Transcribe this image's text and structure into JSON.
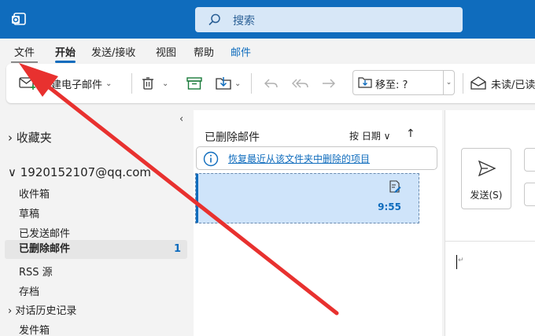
{
  "search": {
    "placeholder": "搜索"
  },
  "menu": {
    "file": "文件",
    "home": "开始",
    "send_receive": "发送/接收",
    "view": "视图",
    "help": "帮助",
    "mail": "邮件"
  },
  "ribbon": {
    "new_mail": "新建电子邮件",
    "move_to": "移至: ?",
    "unread_read": "未读/已读"
  },
  "folders": {
    "favorites": "收藏夹",
    "account": "1920152107@qq.com",
    "items": [
      {
        "label": "收件箱"
      },
      {
        "label": "草稿"
      },
      {
        "label": "已发送邮件"
      },
      {
        "label": "已删除邮件",
        "count": "1"
      },
      {
        "label": "RSS 源"
      },
      {
        "label": "存档"
      },
      {
        "label": "对话历史记录"
      },
      {
        "label": "发件箱"
      }
    ]
  },
  "list": {
    "title": "已删除邮件",
    "sort_label": "按 日期 ∨",
    "sort_direction": "↑",
    "recover_link": "恢复最近从该文件夹中删除的项目",
    "messages": [
      {
        "time": "9:55"
      }
    ]
  },
  "compose": {
    "send_label": "发送(S)"
  },
  "colors": {
    "brand": "#0f6cbd",
    "annotation": "#e8312f",
    "selected_message": "#cfe4fa"
  }
}
